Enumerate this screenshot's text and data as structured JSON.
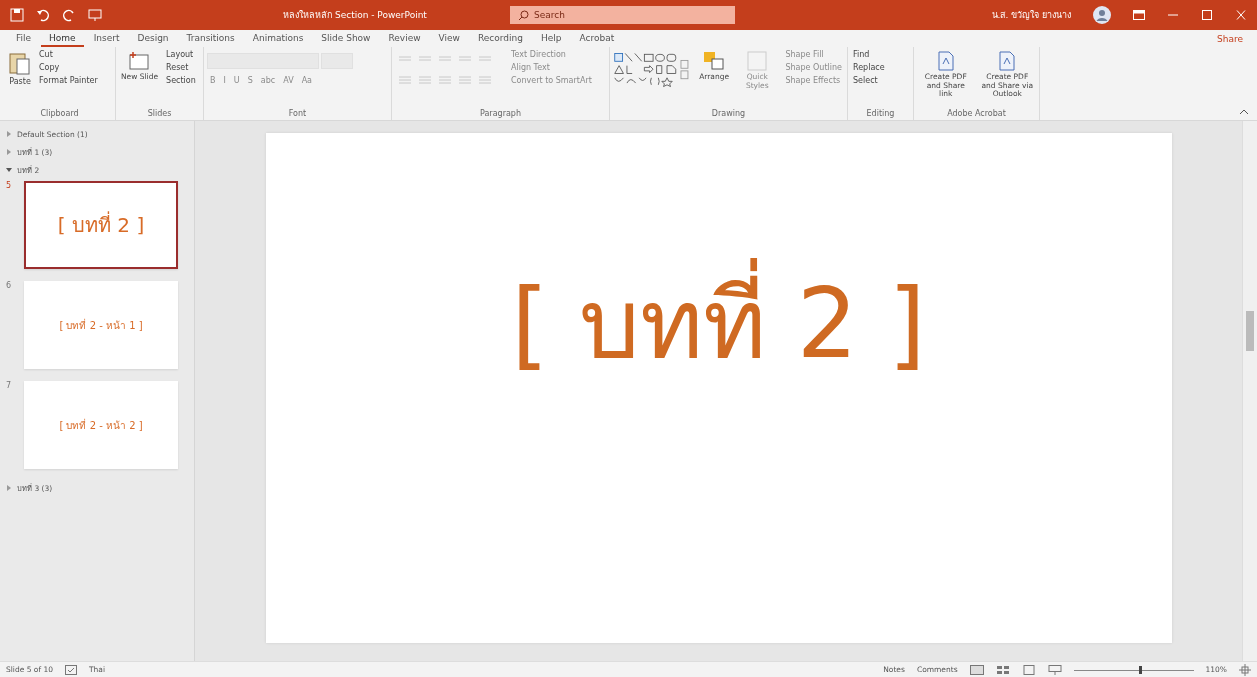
{
  "title_bar": {
    "title": "หลงใหลหลัก Section - PowerPoint",
    "search": {
      "placeholder": "Search"
    },
    "user": "น.ส. ขวัญใจ ยางนาง"
  },
  "tabs": [
    {
      "label": "File",
      "selected": false
    },
    {
      "label": "Home",
      "selected": true
    },
    {
      "label": "Insert",
      "selected": false
    },
    {
      "label": "Design",
      "selected": false
    },
    {
      "label": "Transitions",
      "selected": false
    },
    {
      "label": "Animations",
      "selected": false
    },
    {
      "label": "Slide Show",
      "selected": false
    },
    {
      "label": "Review",
      "selected": false
    },
    {
      "label": "View",
      "selected": false
    },
    {
      "label": "Recording",
      "selected": false
    },
    {
      "label": "Help",
      "selected": false
    },
    {
      "label": "Acrobat",
      "selected": false
    }
  ],
  "share": "Share",
  "ribbon": {
    "clipboard": {
      "label": "Clipboard",
      "paste": "Paste",
      "commands": [
        {
          "label": "Cut",
          "disabled": false
        },
        {
          "label": "Copy",
          "disabled": false
        },
        {
          "label": "Format Painter",
          "disabled": false
        }
      ]
    },
    "slides": {
      "label": "Slides",
      "new_slide": "New Slide",
      "commands": [
        {
          "label": "Layout",
          "disabled": false
        },
        {
          "label": "Reset",
          "disabled": false
        },
        {
          "label": "Section",
          "disabled": false
        }
      ]
    },
    "font": {
      "label": "Font",
      "disabled": true,
      "buttons": [
        "B",
        "I",
        "U",
        "S",
        "abc",
        "AV",
        "Aa"
      ]
    },
    "paragraph": {
      "label": "Paragraph",
      "commands": [
        {
          "label": "Text Direction",
          "disabled": true
        },
        {
          "label": "Align Text",
          "disabled": true
        },
        {
          "label": "Convert to SmartArt",
          "disabled": true
        }
      ]
    },
    "drawing": {
      "label": "Drawing",
      "arrange": "Arrange",
      "quick_styles": "Quick Styles",
      "commands": [
        {
          "label": "Shape Fill",
          "disabled": true
        },
        {
          "label": "Shape Outline",
          "disabled": true
        },
        {
          "label": "Shape Effects",
          "disabled": true
        }
      ]
    },
    "editing": {
      "label": "Editing",
      "commands": [
        {
          "label": "Find",
          "disabled": false
        },
        {
          "label": "Replace",
          "disabled": false
        },
        {
          "label": "Select",
          "disabled": false
        }
      ]
    },
    "acrobat": {
      "label": "Adobe Acrobat",
      "buttons": [
        "Create PDF and Share link",
        "Create PDF and Share via Outlook"
      ]
    }
  },
  "sections": [
    {
      "name": "Default Section (1)",
      "expanded": false
    },
    {
      "name": "บทที่ 1 (3)",
      "expanded": false
    },
    {
      "name": "บทที่ 2",
      "expanded": true,
      "slides": [
        {
          "number": "5",
          "title": "[ บทที่ 2 ]",
          "selected": true
        },
        {
          "number": "6",
          "title": "[ บทที่ 2 - หน้า 1 ]",
          "selected": false
        },
        {
          "number": "7",
          "title": "[ บทที่ 2 - หน้า 2 ]",
          "selected": false
        }
      ]
    },
    {
      "name": "บทที่ 3 (3)",
      "expanded": false
    }
  ],
  "slide": {
    "title": "[ บทที่ 2 ]"
  },
  "status_bar": {
    "slide_info": "Slide 5 of 10",
    "language": "Thai",
    "notes": "Notes",
    "comments": "Comments",
    "zoom": {
      "level": 0.55,
      "reading": "110%"
    }
  }
}
